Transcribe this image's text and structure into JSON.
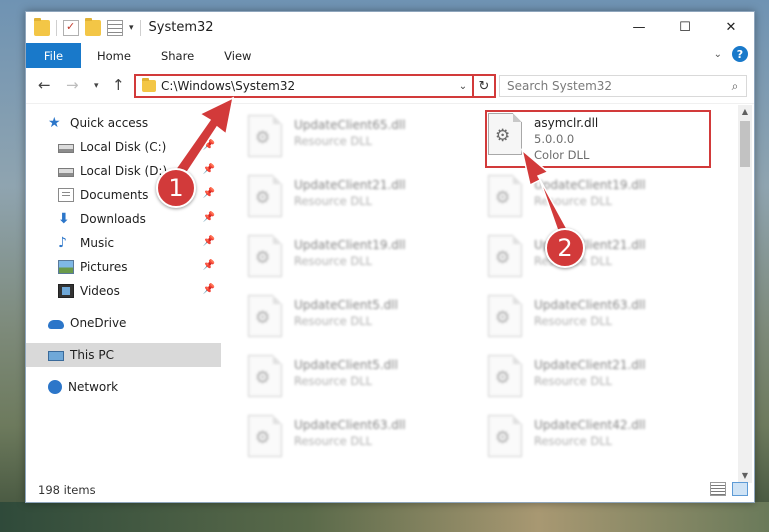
{
  "window": {
    "title": "System32",
    "controls": [
      "—",
      "☐",
      "✕"
    ]
  },
  "ribbon": {
    "tabs": [
      "File",
      "Home",
      "Share",
      "View"
    ]
  },
  "address": {
    "path": "C:\\Windows\\System32",
    "search_placeholder": "Search System32"
  },
  "sidebar": {
    "items": [
      {
        "label": "Quick access",
        "icon": "star-icon"
      },
      {
        "label": "Local Disk (C:)",
        "icon": "drive-icon"
      },
      {
        "label": "Local Disk (D:)",
        "icon": "drive-icon"
      },
      {
        "label": "Documents",
        "icon": "documents-icon"
      },
      {
        "label": "Downloads",
        "icon": "downloads-icon"
      },
      {
        "label": "Music",
        "icon": "music-icon"
      },
      {
        "label": "Pictures",
        "icon": "pictures-icon"
      },
      {
        "label": "Videos",
        "icon": "videos-icon"
      },
      {
        "label": "OneDrive",
        "icon": "cloud-icon"
      },
      {
        "label": "This PC",
        "icon": "computer-icon"
      },
      {
        "label": "Network",
        "icon": "network-icon"
      }
    ]
  },
  "files": [
    {
      "name": "UpdateClient65.dll",
      "sub": "Resource DLL"
    },
    {
      "name": "asymclr.dll",
      "version": "5.0.0.0",
      "sub": "Color DLL"
    },
    {
      "name": "UpdateClient21.dll",
      "sub": "Resource DLL"
    },
    {
      "name": "UpdateClient19.dll",
      "sub": "Resource DLL"
    },
    {
      "name": "UpdateClient19.dll",
      "sub": "Resource DLL"
    },
    {
      "name": "UpdateClient21.dll",
      "sub": "Resource DLL"
    },
    {
      "name": "UpdateClient5.dll",
      "sub": "Resource DLL"
    },
    {
      "name": "UpdateClient63.dll",
      "sub": "Resource DLL"
    },
    {
      "name": "UpdateClient5.dll",
      "sub": "Resource DLL"
    },
    {
      "name": "UpdateClient21.dll",
      "sub": "Resource DLL"
    },
    {
      "name": "UpdateClient63.dll",
      "sub": "Resource DLL"
    },
    {
      "name": "UpdateClient42.dll",
      "sub": "Resource DLL"
    }
  ],
  "status": {
    "item_count": "198 items"
  },
  "annotations": {
    "step1": "1",
    "step2": "2"
  },
  "colors": {
    "accent": "#1979ca",
    "annotation": "#d23a3a"
  }
}
